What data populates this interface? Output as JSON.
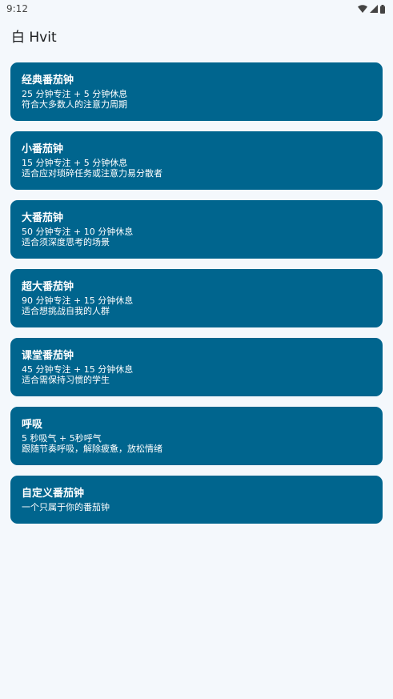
{
  "status_bar": {
    "time": "9:12",
    "icons": [
      "wifi-icon",
      "signal-icon",
      "battery-icon"
    ]
  },
  "app_bar": {
    "title": "白 Hvit"
  },
  "colors": {
    "card_bg": "#00658e",
    "page_bg": "#f4f8fc",
    "card_text": "#ffffff"
  },
  "cards": [
    {
      "title": "经典番茄钟",
      "line1": "25 分钟专注 + 5 分钟休息",
      "line2": "符合大多数人的注意力周期"
    },
    {
      "title": "小番茄钟",
      "line1": "15 分钟专注 + 5 分钟休息",
      "line2": "适合应对琐碎任务或注意力易分散者"
    },
    {
      "title": "大番茄钟",
      "line1": "50 分钟专注 + 10 分钟休息",
      "line2": "适合须深度思考的场景"
    },
    {
      "title": "超大番茄钟",
      "line1": "90 分钟专注 + 15 分钟休息",
      "line2": "适合想挑战自我的人群"
    },
    {
      "title": "课堂番茄钟",
      "line1": "45 分钟专注 + 15 分钟休息",
      "line2": "适合需保持习惯的学生"
    },
    {
      "title": "呼吸",
      "line1": "5 秒吸气 + 5秒呼气",
      "line2": "跟随节奏呼吸，解除疲惫，放松情绪"
    },
    {
      "title": "自定义番茄钟",
      "line1": "一个只属于你的番茄钟"
    }
  ]
}
